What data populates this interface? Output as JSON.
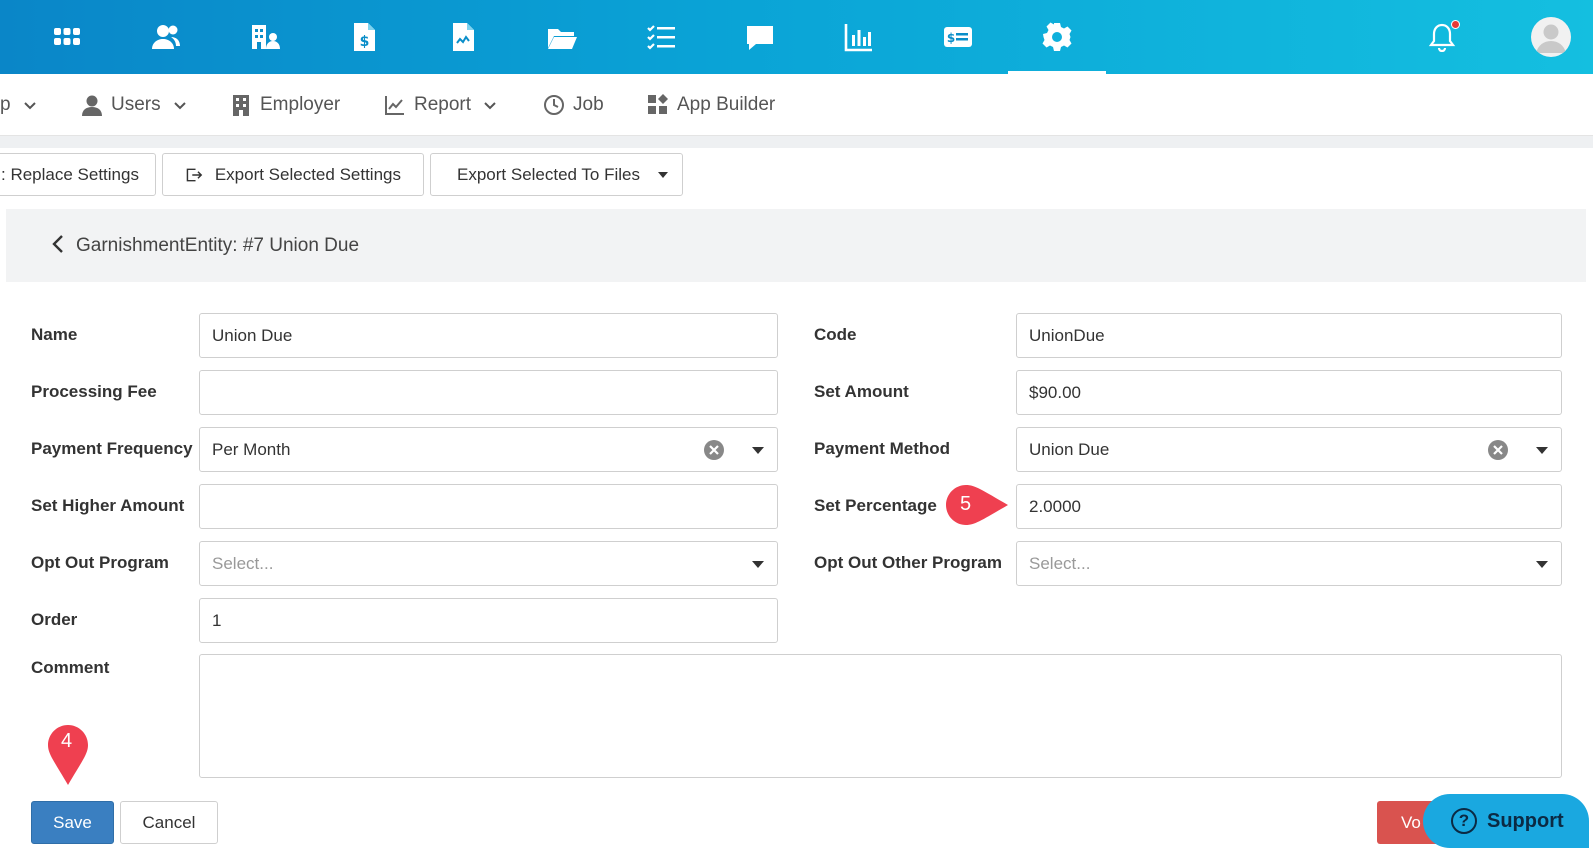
{
  "topbar": {
    "icons": [
      "apps-grid-icon",
      "users-icon",
      "buildings-icon",
      "invoice-dollar-icon",
      "report-file-icon",
      "folder-open-icon",
      "checklist-icon",
      "chat-icon",
      "bar-chart-icon",
      "money-card-icon",
      "gear-icon"
    ],
    "active_icon": "gear-icon",
    "notification_dot_color": "#e53935",
    "gradient_colors": [
      "#0a86c8",
      "#14bfe0"
    ]
  },
  "nav": {
    "items": [
      {
        "label": "p",
        "icon": null,
        "dropdown": true
      },
      {
        "label": "Users",
        "icon": "user-icon",
        "dropdown": true
      },
      {
        "label": "Employer",
        "icon": "building-icon",
        "dropdown": false
      },
      {
        "label": "Report",
        "icon": "line-chart-icon",
        "dropdown": true
      },
      {
        "label": "Job",
        "icon": "clock-icon",
        "dropdown": false
      },
      {
        "label": "App Builder",
        "icon": "app-builder-icon",
        "dropdown": false
      }
    ]
  },
  "toolbar": {
    "replace_label": ": Replace Settings",
    "export_selected_label": "Export Selected Settings",
    "export_files_label": "Export Selected To Files"
  },
  "header": {
    "title": "GarnishmentEntity: #7 Union Due"
  },
  "form": {
    "name": {
      "label": "Name",
      "value": "Union Due"
    },
    "code": {
      "label": "Code",
      "value": "UnionDue"
    },
    "processing_fee": {
      "label": "Processing Fee",
      "value": ""
    },
    "set_amount": {
      "label": "Set Amount",
      "value": "$90.00"
    },
    "payment_frequency": {
      "label": "Payment Frequency",
      "value": "Per Month"
    },
    "payment_method": {
      "label": "Payment Method",
      "value": "Union Due"
    },
    "set_higher_amount": {
      "label": "Set Higher Amount",
      "value": ""
    },
    "set_percentage": {
      "label": "Set Percentage",
      "value": "2.0000"
    },
    "opt_out_program": {
      "label": "Opt Out Program",
      "placeholder": "Select..."
    },
    "opt_out_other_program": {
      "label": "Opt Out Other Program",
      "placeholder": "Select..."
    },
    "order": {
      "label": "Order",
      "value": "1"
    },
    "comment": {
      "label": "Comment",
      "value": ""
    }
  },
  "actions": {
    "save_label": "Save",
    "cancel_label": "Cancel",
    "void_label": "Vo",
    "support_label": "Support",
    "save_color": "#3a7fc1",
    "void_color": "#d9534f",
    "support_color": "#1aa8e0"
  },
  "markers": {
    "step_4": "4",
    "step_5": "5",
    "marker_color": "#ef4050"
  }
}
